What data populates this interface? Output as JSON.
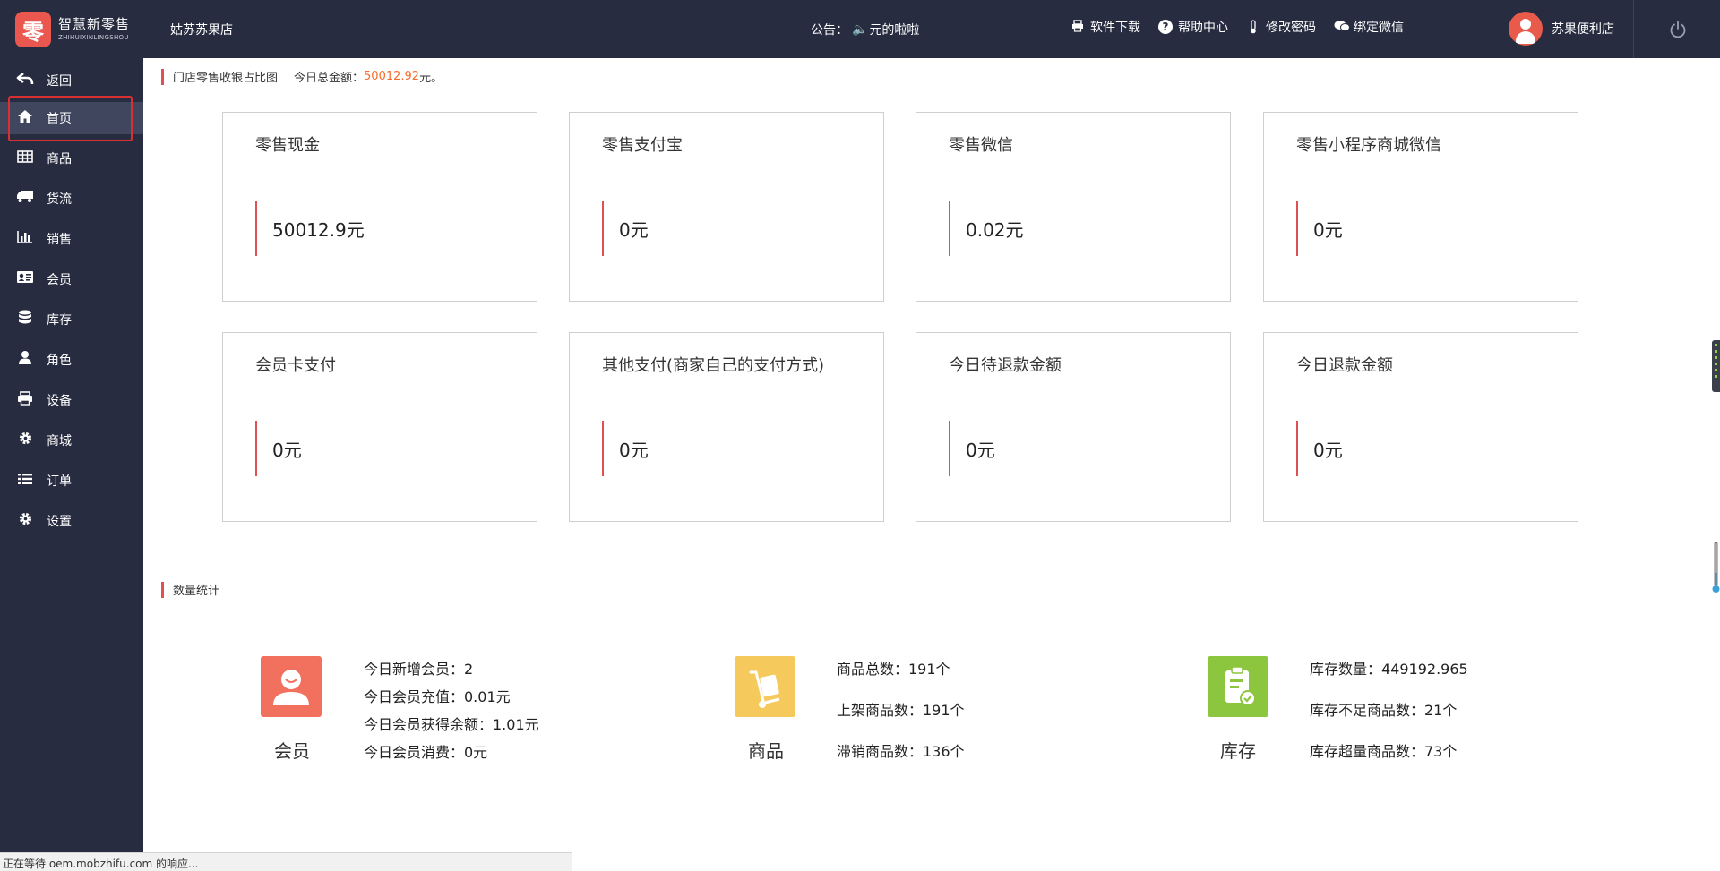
{
  "header": {
    "logo_cn": "智慧新零售",
    "logo_en": "ZHIHUIXINLINGSHOU",
    "logo_mark": "零",
    "store_name": "姑苏苏果店",
    "notice_label": "公告：",
    "notice_text": "元的啦啦",
    "links": [
      {
        "label": "软件下载",
        "icon": "printer-icon"
      },
      {
        "label": "帮助中心",
        "icon": "question-icon"
      },
      {
        "label": "修改密码",
        "icon": "thermometer-icon"
      },
      {
        "label": "绑定微信",
        "icon": "chat-icon"
      }
    ],
    "user_name": "苏果便利店"
  },
  "sidebar": {
    "items": [
      {
        "label": "返回",
        "icon": "back-arrow-icon"
      },
      {
        "label": "首页",
        "icon": "home-icon"
      },
      {
        "label": "商品",
        "icon": "table-icon"
      },
      {
        "label": "货流",
        "icon": "truck-icon"
      },
      {
        "label": "销售",
        "icon": "bar-chart-icon"
      },
      {
        "label": "会员",
        "icon": "id-card-icon"
      },
      {
        "label": "库存",
        "icon": "database-icon"
      },
      {
        "label": "角色",
        "icon": "user-icon"
      },
      {
        "label": "设备",
        "icon": "printer-icon"
      },
      {
        "label": "商城",
        "icon": "gear-icon"
      },
      {
        "label": "订单",
        "icon": "list-icon"
      },
      {
        "label": "设置",
        "icon": "gear-icon"
      }
    ],
    "active_index": 1
  },
  "main": {
    "section1_title": "门店零售收银占比图",
    "total_label": "今日总金额：",
    "total_value": "50012.92",
    "total_unit": "元。",
    "cards": [
      {
        "title": "零售现金",
        "value": "50012.9元"
      },
      {
        "title": "零售支付宝",
        "value": "0元"
      },
      {
        "title": "零售微信",
        "value": "0.02元"
      },
      {
        "title": "零售小程序商城微信",
        "value": "0元"
      },
      {
        "title": "会员卡支付",
        "value": "0元"
      },
      {
        "title": "其他支付(商家自己的支付方式)",
        "value": "0元"
      },
      {
        "title": "今日待退款金额",
        "value": "0元"
      },
      {
        "title": "今日退款金额",
        "value": "0元"
      }
    ],
    "section2_title": "数量统计",
    "stats": [
      {
        "label": "会员",
        "color": "#f2705e",
        "lines": [
          "今日新增会员：2",
          "今日会员充值：0.01元",
          "今日会员获得余额：1.01元",
          "今日会员消费：0元"
        ]
      },
      {
        "label": "商品",
        "color": "#f5c95c",
        "lines": [
          "商品总数：191个",
          "上架商品数：191个",
          "滞销商品数：136个"
        ]
      },
      {
        "label": "库存",
        "color": "#8cc63f",
        "lines": [
          "库存数量：449192.965",
          "库存不足商品数：21个",
          "库存超量商品数：73个"
        ]
      }
    ]
  },
  "status_bar": "正在等待 oem.mobzhifu.com 的响应..."
}
